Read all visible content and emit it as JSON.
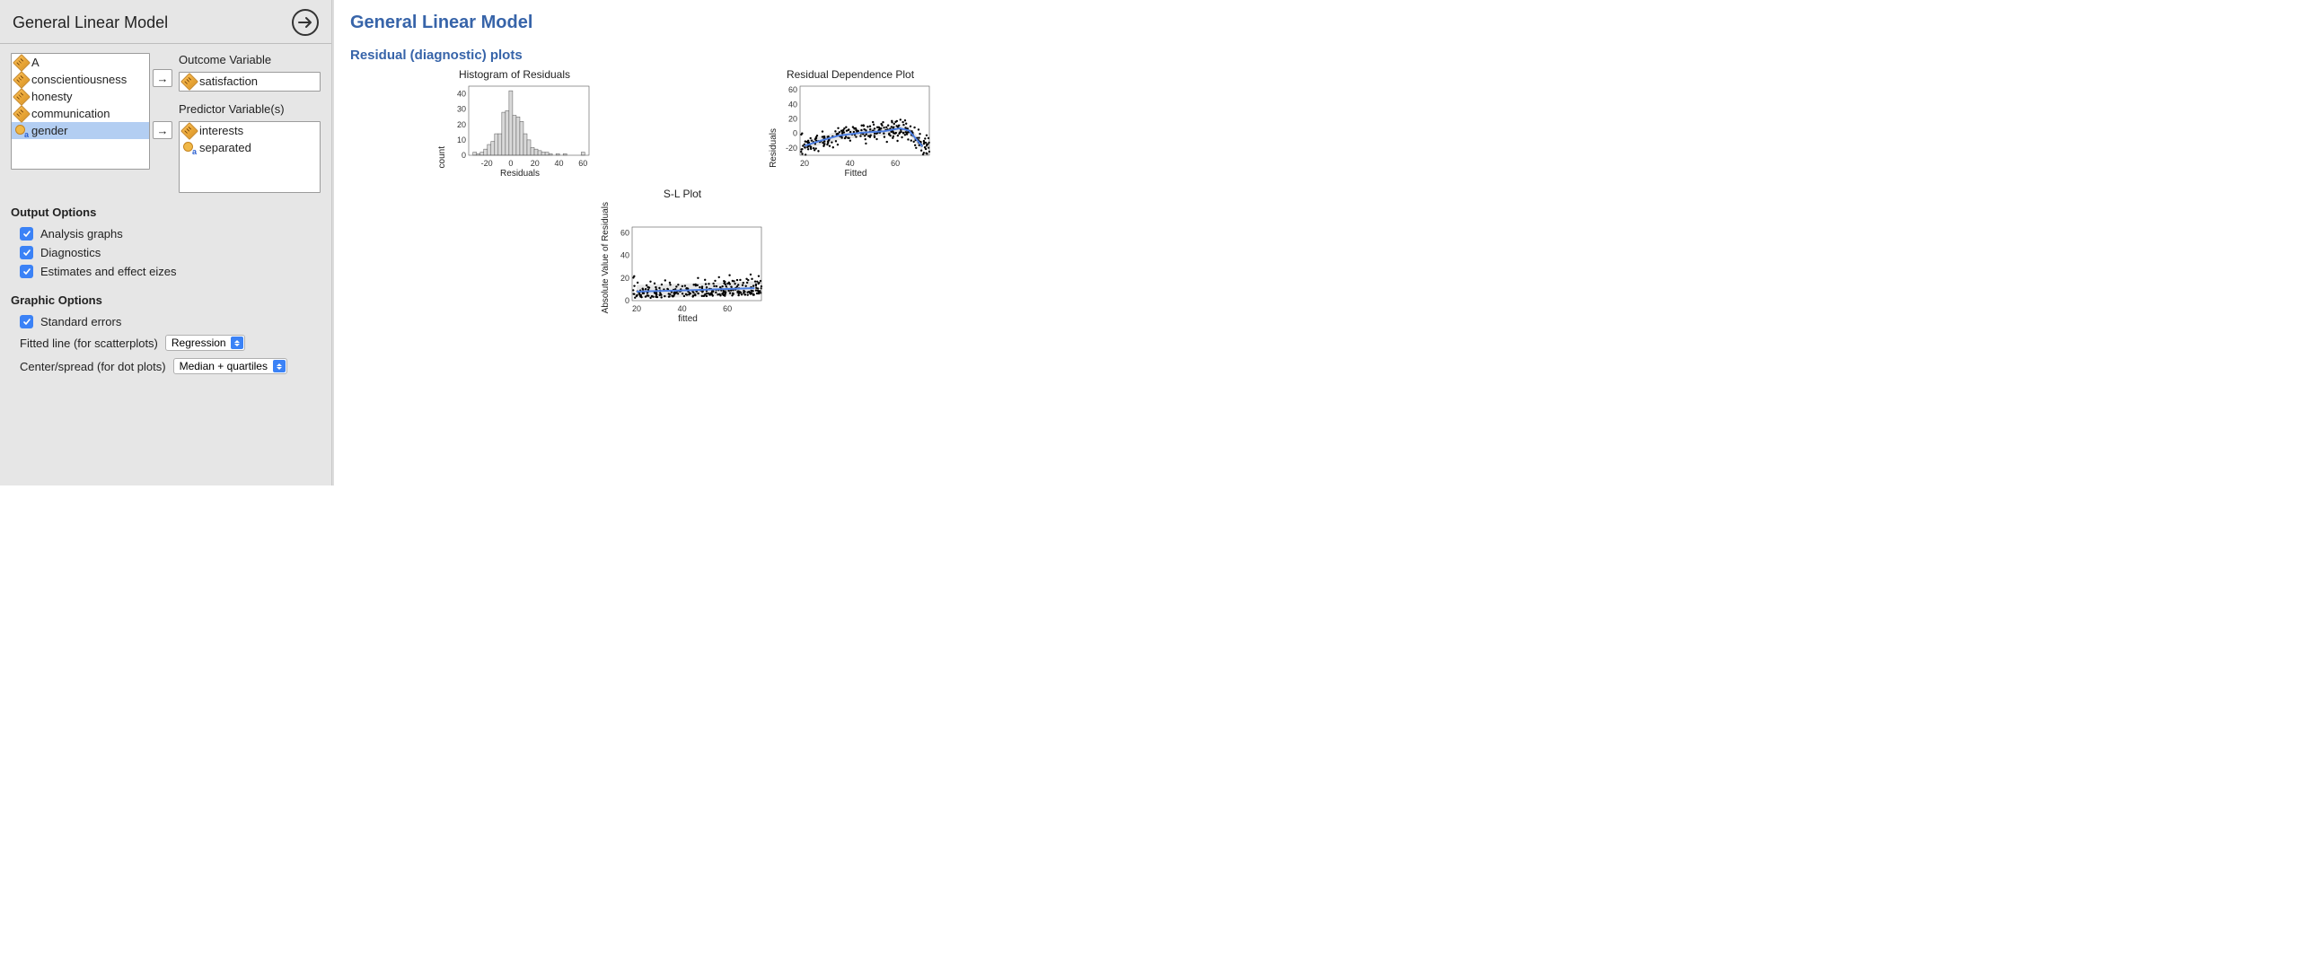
{
  "left": {
    "title": "General Linear Model",
    "variables": [
      {
        "label": "A",
        "type": "scale"
      },
      {
        "label": "conscientiousness",
        "type": "scale"
      },
      {
        "label": "honesty",
        "type": "scale"
      },
      {
        "label": "communication",
        "type": "scale"
      },
      {
        "label": "gender",
        "type": "nominal",
        "selected": true
      }
    ],
    "outcome_label": "Outcome Variable",
    "outcome": {
      "label": "satisfaction",
      "type": "scale"
    },
    "predictors_label": "Predictor Variable(s)",
    "predictors": [
      {
        "label": "interests",
        "type": "scale"
      },
      {
        "label": "separated",
        "type": "nominal"
      }
    ],
    "output_options_heading": "Output Options",
    "output_options": [
      {
        "label": "Analysis graphs",
        "checked": true
      },
      {
        "label": "Diagnostics",
        "checked": true
      },
      {
        "label": "Estimates and effect eizes",
        "checked": true
      }
    ],
    "graphic_options_heading": "Graphic Options",
    "graphic_checkboxes": [
      {
        "label": "Standard errors",
        "checked": true
      }
    ],
    "fitted_line_label": "Fitted line (for scatterplots)",
    "fitted_line_selected": "Regression",
    "center_spread_label": "Center/spread (for dot plots)",
    "center_spread_selected": "Median + quartiles"
  },
  "right": {
    "title": "General Linear Model",
    "section": "Residual (diagnostic) plots",
    "hist_title": "Histogram of Residuals",
    "depend_title": "Residual Dependence Plot",
    "sl_title": "S-L Plot",
    "count_label": "count",
    "residuals_label": "Residuals",
    "fitted_cap": "Fitted",
    "fitted_low": "fitted",
    "abs_label": "Absolute Value of Residuals"
  },
  "chart_data": [
    {
      "type": "bar",
      "title": "Histogram of Residuals",
      "xlabel": "Residuals",
      "ylabel": "count",
      "xlim": [
        -35,
        65
      ],
      "ylim": [
        0,
        45
      ],
      "xticks": [
        -20,
        0,
        20,
        40,
        60
      ],
      "yticks": [
        0,
        10,
        20,
        30,
        40
      ],
      "bin_width": 3,
      "bins": [
        {
          "mid": -30,
          "count": 2
        },
        {
          "mid": -27,
          "count": 1
        },
        {
          "mid": -24,
          "count": 2
        },
        {
          "mid": -21,
          "count": 4
        },
        {
          "mid": -18,
          "count": 7
        },
        {
          "mid": -15,
          "count": 9
        },
        {
          "mid": -12,
          "count": 14
        },
        {
          "mid": -9,
          "count": 14
        },
        {
          "mid": -6,
          "count": 28
        },
        {
          "mid": -3,
          "count": 29
        },
        {
          "mid": 0,
          "count": 42
        },
        {
          "mid": 3,
          "count": 26
        },
        {
          "mid": 6,
          "count": 25
        },
        {
          "mid": 9,
          "count": 22
        },
        {
          "mid": 12,
          "count": 14
        },
        {
          "mid": 15,
          "count": 10
        },
        {
          "mid": 18,
          "count": 5
        },
        {
          "mid": 21,
          "count": 4
        },
        {
          "mid": 24,
          "count": 3
        },
        {
          "mid": 27,
          "count": 2
        },
        {
          "mid": 30,
          "count": 2
        },
        {
          "mid": 33,
          "count": 1
        },
        {
          "mid": 36,
          "count": 0
        },
        {
          "mid": 39,
          "count": 1
        },
        {
          "mid": 42,
          "count": 0
        },
        {
          "mid": 45,
          "count": 1
        },
        {
          "mid": 60,
          "count": 2
        }
      ]
    },
    {
      "type": "scatter",
      "title": "Residual Dependence Plot",
      "xlabel": "Fitted",
      "ylabel": "Residuals",
      "xlim": [
        18,
        75
      ],
      "ylim": [
        -30,
        65
      ],
      "xticks": [
        20,
        40,
        60
      ],
      "yticks": [
        -20,
        0,
        20,
        40,
        60
      ],
      "smooth": [
        {
          "x": 20,
          "y": -17
        },
        {
          "x": 27,
          "y": -10
        },
        {
          "x": 35,
          "y": -3
        },
        {
          "x": 45,
          "y": 1
        },
        {
          "x": 55,
          "y": 3
        },
        {
          "x": 62,
          "y": 7
        },
        {
          "x": 66,
          "y": 4
        },
        {
          "x": 72,
          "y": -18
        }
      ],
      "n_points": 270
    },
    {
      "type": "scatter",
      "title": "S-L Plot",
      "xlabel": "fitted",
      "ylabel": "Absolute Value of Residuals",
      "xlim": [
        18,
        75
      ],
      "ylim": [
        0,
        65
      ],
      "xticks": [
        20,
        40,
        60
      ],
      "yticks": [
        0,
        20,
        40,
        60
      ],
      "smooth": [
        {
          "x": 20,
          "y": 8
        },
        {
          "x": 40,
          "y": 9
        },
        {
          "x": 55,
          "y": 10
        },
        {
          "x": 72,
          "y": 11
        }
      ],
      "n_points": 270
    }
  ]
}
